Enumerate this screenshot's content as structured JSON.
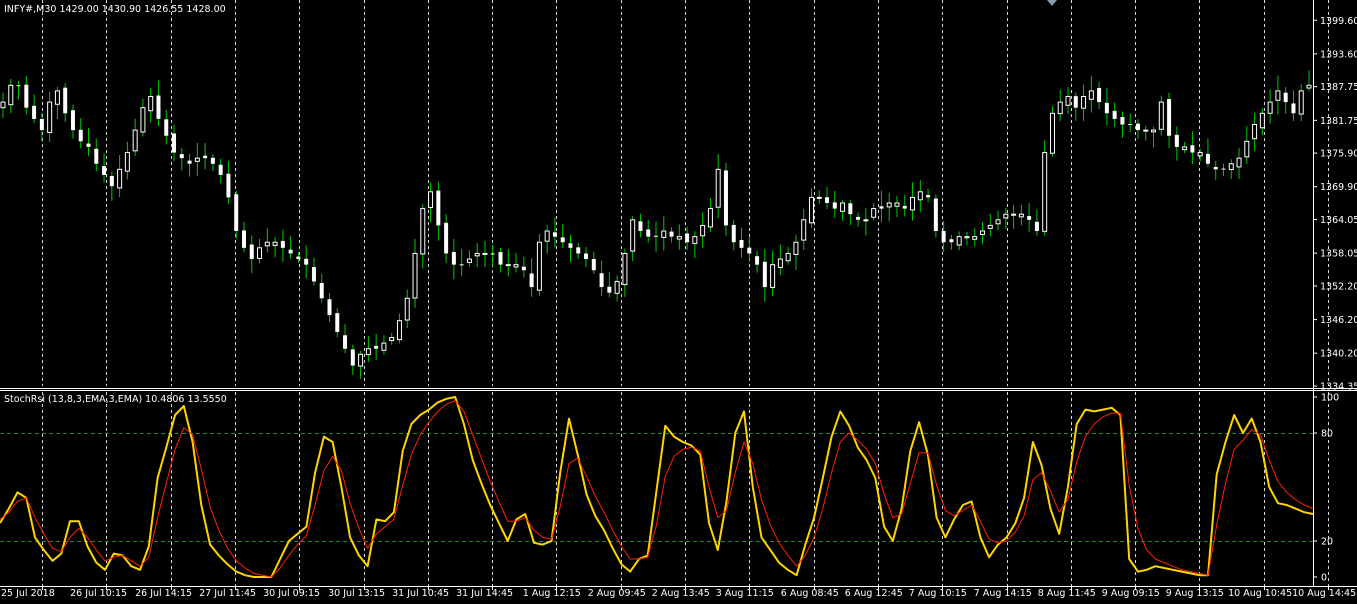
{
  "window": {
    "price_header": "INFY#,M30  1429.00 1430.90 1426.55 1428.00",
    "indicator_header": "StochRsi (13,8,3,EMA,3,EMA) 10.4806 13.5550"
  },
  "colors": {
    "background": "#000000",
    "bull_candle": "#ffffff",
    "bear_candle": "#ffffff",
    "wick": "#00c800",
    "grid": "#ffffff",
    "k_line": "#ffd400",
    "d_line": "#ff2000",
    "level_line": "#2a8a2a"
  },
  "chart_data": [
    {
      "type": "candlestick",
      "symbol": "INFY#",
      "timeframe": "M30",
      "ylim": [
        1334.35,
        1402.5
      ],
      "y_ticks": [
        1399.6,
        1393.6,
        1387.75,
        1381.75,
        1375.9,
        1369.9,
        1364.05,
        1358.05,
        1352.2,
        1346.2,
        1340.2,
        1334.35
      ],
      "x_ticks": [
        "25 Jul 2018",
        "26 Jul 10:15",
        "26 Jul 14:15",
        "27 Jul 11:45",
        "30 Jul 09:15",
        "30 Jul 13:15",
        "31 Jul 10:45",
        "31 Jul 14:45",
        "1 Aug 12:15",
        "2 Aug 09:45",
        "2 Aug 13:45",
        "3 Aug 11:15",
        "6 Aug 08:45",
        "6 Aug 12:45",
        "7 Aug 10:15",
        "7 Aug 14:15",
        "8 Aug 11:45",
        "9 Aug 09:15",
        "9 Aug 13:15",
        "10 Aug 10:45",
        "10 Aug 14:45"
      ],
      "close_path": [
        1385,
        1388,
        1388,
        1384,
        1382,
        1380,
        1385,
        1387,
        1383,
        1380,
        1378,
        1377,
        1374,
        1372,
        1370,
        1373,
        1376,
        1380,
        1384,
        1386,
        1382,
        1379,
        1376,
        1375,
        1374,
        1375,
        1375,
        1374,
        1372,
        1368,
        1362,
        1359,
        1357,
        1359,
        1360,
        1360,
        1359,
        1358,
        1357,
        1356,
        1353,
        1350,
        1347,
        1344,
        1341,
        1338,
        1340,
        1341,
        1341,
        1342,
        1343,
        1346,
        1350,
        1358,
        1366,
        1369,
        1363,
        1358,
        1356,
        1356,
        1357,
        1358,
        1358,
        1358,
        1356,
        1356,
        1356,
        1355,
        1352,
        1360,
        1362,
        1361,
        1360,
        1359,
        1358,
        1357,
        1355,
        1352,
        1351,
        1353,
        1358,
        1364,
        1362,
        1361,
        1361,
        1362,
        1361,
        1361,
        1360,
        1361,
        1363,
        1366,
        1373,
        1363,
        1360,
        1359,
        1358,
        1356,
        1352,
        1356,
        1357,
        1358,
        1360,
        1364,
        1368,
        1368,
        1367,
        1366,
        1367,
        1365,
        1364,
        1364,
        1366,
        1366,
        1367,
        1367,
        1366,
        1368,
        1369,
        1368,
        1362,
        1360,
        1360,
        1361,
        1361,
        1361,
        1362,
        1363,
        1364,
        1365,
        1365,
        1365,
        1364,
        1362,
        1376,
        1383,
        1385,
        1386,
        1384,
        1386,
        1387,
        1385,
        1383,
        1382,
        1381,
        1381,
        1380,
        1380,
        1380,
        1385,
        1379,
        1377,
        1377,
        1376,
        1376,
        1374,
        1373,
        1373,
        1374,
        1375,
        1378,
        1381,
        1383,
        1385,
        1387,
        1385,
        1383,
        1387,
        1388
      ]
    },
    {
      "type": "line",
      "title": "StochRsi (13,8,3,EMA,3,EMA) 10.4806 13.5550",
      "ylim": [
        0,
        100
      ],
      "y_ticks": [
        100,
        80,
        20,
        0
      ],
      "levels": [
        80,
        20
      ],
      "series": [
        {
          "values": [
            30,
            38,
            47,
            44,
            22,
            15,
            9,
            13,
            31,
            31,
            17,
            8,
            4,
            13,
            12,
            6,
            4,
            17,
            55,
            72,
            90,
            95,
            75,
            40,
            18,
            12,
            7,
            3,
            1,
            0,
            0,
            0,
            10,
            20,
            24,
            28,
            58,
            78,
            75,
            50,
            22,
            12,
            6,
            32,
            31,
            36,
            70,
            85,
            90,
            93,
            97,
            99,
            100,
            85,
            65,
            52,
            40,
            30,
            20,
            32,
            35,
            19,
            18,
            20,
            58,
            88,
            68,
            46,
            34,
            26,
            16,
            7,
            3,
            10,
            12,
            48,
            84,
            78,
            75,
            73,
            68,
            30,
            15,
            42,
            80,
            92,
            50,
            22,
            15,
            8,
            4,
            1,
            18,
            33,
            55,
            78,
            92,
            84,
            72,
            65,
            55,
            28,
            20,
            38,
            70,
            86,
            68,
            33,
            22,
            32,
            40,
            42,
            22,
            11,
            18,
            22,
            30,
            44,
            75,
            62,
            38,
            24,
            50,
            85,
            93,
            92,
            93,
            94,
            90,
            10,
            3,
            4,
            6,
            5,
            4,
            3,
            2,
            1,
            1,
            57,
            75,
            90,
            80,
            88,
            75,
            50,
            41,
            40,
            38,
            36,
            35
          ],
          "color": "#ffd400"
        },
        {
          "values": [
            32,
            36,
            42,
            44,
            33,
            24,
            16,
            14,
            22,
            27,
            22,
            15,
            9,
            11,
            12,
            9,
            6,
            11,
            33,
            52,
            71,
            83,
            79,
            60,
            39,
            26,
            16,
            9,
            5,
            2,
            1,
            0,
            5,
            12,
            18,
            23,
            40,
            59,
            67,
            59,
            41,
            27,
            16,
            24,
            28,
            32,
            51,
            68,
            79,
            86,
            92,
            96,
            98,
            92,
            79,
            66,
            53,
            42,
            31,
            31,
            33,
            26,
            22,
            21,
            39,
            63,
            66,
            56,
            45,
            36,
            26,
            17,
            10,
            10,
            11,
            29,
            56,
            67,
            71,
            72,
            70,
            50,
            33,
            37,
            58,
            75,
            63,
            43,
            29,
            19,
            12,
            6,
            12,
            22,
            38,
            58,
            75,
            80,
            76,
            71,
            63,
            46,
            33,
            35,
            52,
            69,
            69,
            51,
            37,
            34,
            37,
            40,
            31,
            21,
            19,
            20,
            25,
            34,
            54,
            58,
            48,
            36,
            43,
            64,
            78,
            85,
            89,
            91,
            91,
            51,
            27,
            15,
            10,
            8,
            6,
            4,
            3,
            2,
            1,
            29,
            52,
            71,
            76,
            82,
            79,
            65,
            53,
            47,
            43,
            40,
            38
          ],
          "color": "#ff2000"
        }
      ]
    }
  ]
}
